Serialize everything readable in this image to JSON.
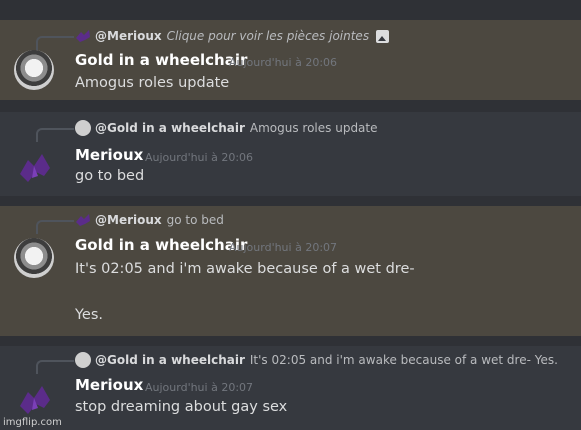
{
  "messages": [
    {
      "reply_to": {
        "author": "@Merioux",
        "text": "Clique pour voir les pièces jointes",
        "attachment_icon": "image-icon"
      },
      "author": "Gold in a wheelchair",
      "timestamp": "Aujourd'hui à 20:06",
      "lines": [
        "Amogus roles update"
      ]
    },
    {
      "reply_to": {
        "author": "@Gold in a wheelchair",
        "text": "Amogus roles update"
      },
      "author": "Merioux",
      "timestamp": "Aujourd'hui à 20:06",
      "lines": [
        "go to bed"
      ]
    },
    {
      "reply_to": {
        "author": "@Merioux",
        "text": "go to bed"
      },
      "author": "Gold in a wheelchair",
      "timestamp": "Aujourd'hui à 20:07",
      "lines": [
        "It's 02:05 and i'm awake because of a wet dre-",
        "Yes."
      ]
    },
    {
      "reply_to": {
        "author": "@Gold in a wheelchair",
        "text": "It's 02:05 and i'm awake because of a wet dre-  Yes."
      },
      "author": "Merioux",
      "timestamp": "Aujourd'hui à 20:07",
      "lines": [
        "stop dreaming about gay sex"
      ]
    }
  ],
  "watermark": "imgflip.com",
  "colors": {
    "highlight": "#4c4840",
    "background": "#36393f",
    "merioux_purple": "#5b2c8a"
  }
}
